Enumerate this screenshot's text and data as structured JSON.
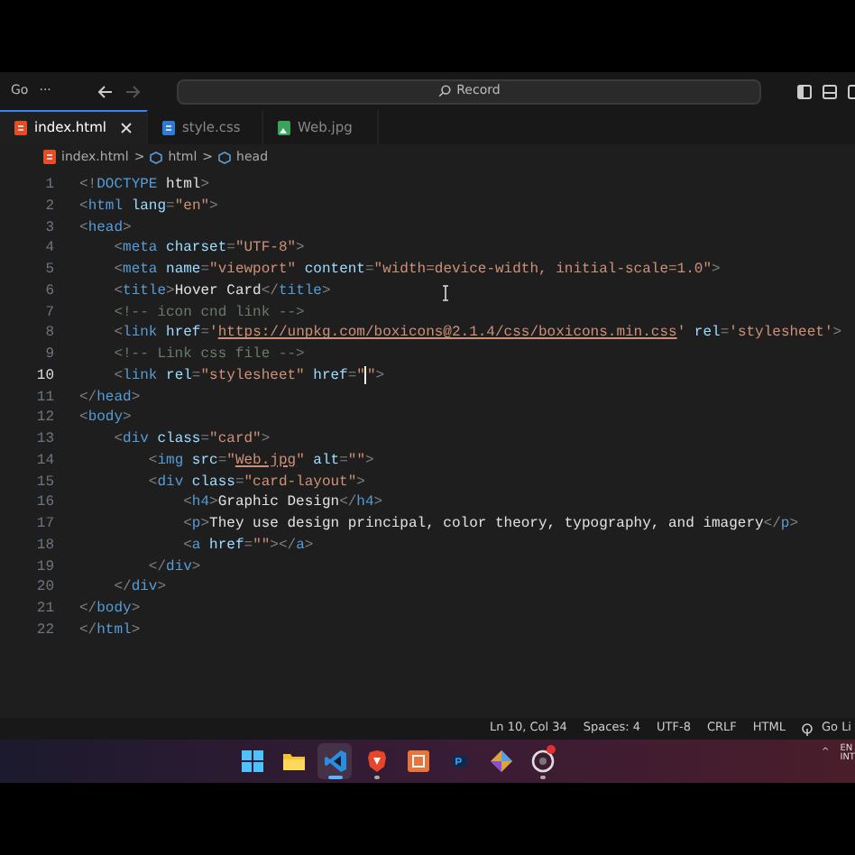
{
  "title_bar": {
    "menu": "Go",
    "more": "···",
    "back_disabled": false,
    "forward_disabled": true,
    "search": {
      "placeholder": "Record"
    }
  },
  "tabs": [
    {
      "label": "index.html",
      "kind": "html",
      "selected": true
    },
    {
      "label": "style.css",
      "kind": "css",
      "selected": false
    },
    {
      "label": "Web.jpg",
      "kind": "image",
      "selected": false
    }
  ],
  "breadcrumb": [
    {
      "label": "index.html",
      "kind": "html"
    },
    {
      "label": "html",
      "kind": "element"
    },
    {
      "label": "head",
      "kind": "element"
    }
  ],
  "breadcrumb_separator": ">",
  "code_lines": [
    {
      "number": "1",
      "active": false,
      "tokens": [
        {
          "kind": "p",
          "text": "<!"
        },
        {
          "kind": "tag",
          "text": "DOCTYPE"
        },
        {
          "kind": "txt",
          "text": " html"
        },
        {
          "kind": "p",
          "text": ">"
        }
      ]
    },
    {
      "number": "2",
      "active": false,
      "tokens": [
        {
          "kind": "p",
          "text": "<"
        },
        {
          "kind": "tag",
          "text": "html"
        },
        {
          "kind": "attr",
          "text": " lang"
        },
        {
          "kind": "p",
          "text": "="
        },
        {
          "kind": "str",
          "text": "\"en\""
        },
        {
          "kind": "p",
          "text": ">"
        }
      ]
    },
    {
      "number": "3",
      "active": false,
      "tokens": [
        {
          "kind": "p",
          "text": "<"
        },
        {
          "kind": "tag",
          "text": "head"
        },
        {
          "kind": "p",
          "text": ">"
        }
      ]
    },
    {
      "number": "4",
      "active": false,
      "tokens": [
        {
          "kind": "p",
          "text": "    <"
        },
        {
          "kind": "tag",
          "text": "meta"
        },
        {
          "kind": "attr",
          "text": " charset"
        },
        {
          "kind": "p",
          "text": "="
        },
        {
          "kind": "str",
          "text": "\"UTF-8\""
        },
        {
          "kind": "p",
          "text": ">"
        }
      ]
    },
    {
      "number": "5",
      "active": false,
      "tokens": [
        {
          "kind": "p",
          "text": "    <"
        },
        {
          "kind": "tag",
          "text": "meta"
        },
        {
          "kind": "attr",
          "text": " name"
        },
        {
          "kind": "p",
          "text": "="
        },
        {
          "kind": "str",
          "text": "\"viewport\""
        },
        {
          "kind": "attr",
          "text": " content"
        },
        {
          "kind": "p",
          "text": "="
        },
        {
          "kind": "str",
          "text": "\"width=device-width, initial-scale=1.0\""
        },
        {
          "kind": "p",
          "text": ">"
        }
      ]
    },
    {
      "number": "6",
      "active": false,
      "tokens": [
        {
          "kind": "p",
          "text": "    <"
        },
        {
          "kind": "tag",
          "text": "title"
        },
        {
          "kind": "p",
          "text": ">"
        },
        {
          "kind": "txt",
          "text": "Hover Card"
        },
        {
          "kind": "p",
          "text": "</"
        },
        {
          "kind": "tag",
          "text": "title"
        },
        {
          "kind": "p",
          "text": ">"
        }
      ]
    },
    {
      "number": "7",
      "active": false,
      "tokens": [
        {
          "kind": "cmt",
          "text": "    <!-- icon cnd link -->"
        }
      ]
    },
    {
      "number": "8",
      "active": false,
      "tokens": [
        {
          "kind": "p",
          "text": "    <"
        },
        {
          "kind": "tag",
          "text": "link"
        },
        {
          "kind": "attr",
          "text": " href"
        },
        {
          "kind": "p",
          "text": "="
        },
        {
          "kind": "str",
          "text": "'"
        },
        {
          "kind": "url",
          "text": "https://unpkg.com/boxicons@2.1.4/css/boxicons.min.css"
        },
        {
          "kind": "str",
          "text": "'"
        },
        {
          "kind": "attr",
          "text": " rel"
        },
        {
          "kind": "p",
          "text": "="
        },
        {
          "kind": "str",
          "text": "'stylesheet'"
        },
        {
          "kind": "p",
          "text": ">"
        }
      ]
    },
    {
      "number": "9",
      "active": false,
      "tokens": [
        {
          "kind": "cmt",
          "text": "    <!-- Link css file -->"
        }
      ]
    },
    {
      "number": "10",
      "active": true,
      "tokens": [
        {
          "kind": "p",
          "text": "    <"
        },
        {
          "kind": "tag",
          "text": "link"
        },
        {
          "kind": "attr",
          "text": " rel"
        },
        {
          "kind": "p",
          "text": "="
        },
        {
          "kind": "str",
          "text": "\"stylesheet\""
        },
        {
          "kind": "attr",
          "text": " href"
        },
        {
          "kind": "p",
          "text": "="
        },
        {
          "kind": "str",
          "text": "\""
        },
        {
          "kind": "caret"
        },
        {
          "kind": "str",
          "text": "\""
        },
        {
          "kind": "p",
          "text": ">"
        }
      ]
    },
    {
      "number": "11",
      "active": false,
      "tokens": [
        {
          "kind": "p",
          "text": "</"
        },
        {
          "kind": "tag",
          "text": "head"
        },
        {
          "kind": "p",
          "text": ">"
        }
      ]
    },
    {
      "number": "12",
      "active": false,
      "tokens": [
        {
          "kind": "p",
          "text": "<"
        },
        {
          "kind": "tag",
          "text": "body"
        },
        {
          "kind": "p",
          "text": ">"
        }
      ]
    },
    {
      "number": "13",
      "active": false,
      "tokens": [
        {
          "kind": "p",
          "text": "    <"
        },
        {
          "kind": "tag",
          "text": "div"
        },
        {
          "kind": "attr",
          "text": " class"
        },
        {
          "kind": "p",
          "text": "="
        },
        {
          "kind": "str",
          "text": "\"card\""
        },
        {
          "kind": "p",
          "text": ">"
        }
      ]
    },
    {
      "number": "14",
      "active": false,
      "tokens": [
        {
          "kind": "p",
          "text": "        <"
        },
        {
          "kind": "tag",
          "text": "img"
        },
        {
          "kind": "attr",
          "text": " src"
        },
        {
          "kind": "p",
          "text": "="
        },
        {
          "kind": "str",
          "text": "\""
        },
        {
          "kind": "url",
          "text": "Web.jpg"
        },
        {
          "kind": "str",
          "text": "\""
        },
        {
          "kind": "attr",
          "text": " alt"
        },
        {
          "kind": "p",
          "text": "="
        },
        {
          "kind": "str",
          "text": "\"\""
        },
        {
          "kind": "p",
          "text": ">"
        }
      ]
    },
    {
      "number": "15",
      "active": false,
      "tokens": [
        {
          "kind": "p",
          "text": "        <"
        },
        {
          "kind": "tag",
          "text": "div"
        },
        {
          "kind": "attr",
          "text": " class"
        },
        {
          "kind": "p",
          "text": "="
        },
        {
          "kind": "str",
          "text": "\"card-layout\""
        },
        {
          "kind": "p",
          "text": ">"
        }
      ]
    },
    {
      "number": "16",
      "active": false,
      "tokens": [
        {
          "kind": "p",
          "text": "            <"
        },
        {
          "kind": "tag",
          "text": "h4"
        },
        {
          "kind": "p",
          "text": ">"
        },
        {
          "kind": "txt",
          "text": "Graphic Design"
        },
        {
          "kind": "p",
          "text": "</"
        },
        {
          "kind": "tag",
          "text": "h4"
        },
        {
          "kind": "p",
          "text": ">"
        }
      ]
    },
    {
      "number": "17",
      "active": false,
      "tokens": [
        {
          "kind": "p",
          "text": "            <"
        },
        {
          "kind": "tag",
          "text": "p"
        },
        {
          "kind": "p",
          "text": ">"
        },
        {
          "kind": "txt",
          "text": "They use design principal, color theory, typography, and imagery"
        },
        {
          "kind": "p",
          "text": "</"
        },
        {
          "kind": "tag",
          "text": "p"
        },
        {
          "kind": "p",
          "text": ">"
        }
      ]
    },
    {
      "number": "18",
      "active": false,
      "tokens": [
        {
          "kind": "p",
          "text": "            <"
        },
        {
          "kind": "tag",
          "text": "a"
        },
        {
          "kind": "attr",
          "text": " href"
        },
        {
          "kind": "p",
          "text": "="
        },
        {
          "kind": "str",
          "text": "\"\""
        },
        {
          "kind": "p",
          "text": "></"
        },
        {
          "kind": "tag",
          "text": "a"
        },
        {
          "kind": "p",
          "text": ">"
        }
      ]
    },
    {
      "number": "19",
      "active": false,
      "tokens": [
        {
          "kind": "p",
          "text": "        </"
        },
        {
          "kind": "tag",
          "text": "div"
        },
        {
          "kind": "p",
          "text": ">"
        }
      ]
    },
    {
      "number": "20",
      "active": false,
      "tokens": [
        {
          "kind": "p",
          "text": "    </"
        },
        {
          "kind": "tag",
          "text": "div"
        },
        {
          "kind": "p",
          "text": ">"
        }
      ]
    },
    {
      "number": "21",
      "active": false,
      "tokens": [
        {
          "kind": "p",
          "text": "</"
        },
        {
          "kind": "tag",
          "text": "body"
        },
        {
          "kind": "p",
          "text": ">"
        }
      ]
    },
    {
      "number": "22",
      "active": false,
      "tokens": [
        {
          "kind": "p",
          "text": "</"
        },
        {
          "kind": "tag",
          "text": "html"
        },
        {
          "kind": "p",
          "text": ">"
        }
      ]
    }
  ],
  "status_bar": [
    {
      "label": "Ln 10, Col 34",
      "icon": false
    },
    {
      "label": "Spaces: 4",
      "icon": false
    },
    {
      "label": "UTF-8",
      "icon": false
    },
    {
      "label": "CRLF",
      "icon": false
    },
    {
      "label": "HTML",
      "icon": false
    },
    {
      "label": "Go Li",
      "icon": true
    }
  ],
  "taskbar": {
    "apps": [
      {
        "kind": "start",
        "selected": false,
        "running": false,
        "badge": false
      },
      {
        "kind": "folder",
        "selected": false,
        "running": false,
        "badge": false
      },
      {
        "kind": "vscode",
        "selected": true,
        "running": true,
        "badge": false
      },
      {
        "kind": "shield",
        "selected": false,
        "running": true,
        "badge": false
      },
      {
        "kind": "frame",
        "selected": false,
        "running": false,
        "badge": false
      },
      {
        "kind": "ps",
        "selected": false,
        "running": false,
        "badge": false
      },
      {
        "kind": "diamond",
        "selected": false,
        "running": false,
        "badge": false
      },
      {
        "kind": "ring",
        "selected": false,
        "running": true,
        "badge": true
      }
    ],
    "tray_caret": "^",
    "language": [
      "EN",
      "INT"
    ]
  }
}
